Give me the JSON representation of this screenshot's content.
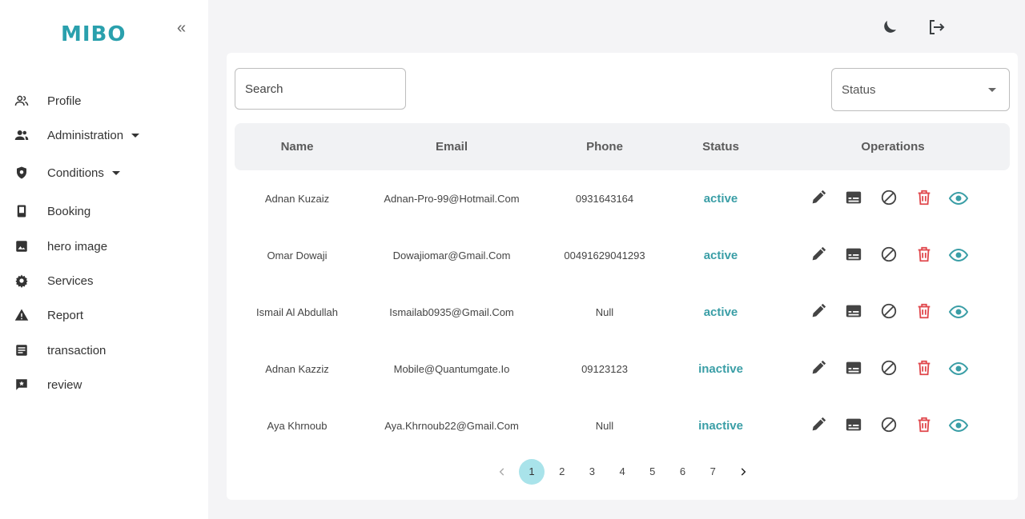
{
  "brand": {
    "logo": "MIBO",
    "accent": "#2aa0ad"
  },
  "sidebar": {
    "collapse_icon": "double-chevron-left-icon",
    "items": [
      {
        "label": "Profile",
        "icon": "users-icon"
      },
      {
        "label": "Administration",
        "icon": "group-icon",
        "has_submenu": true
      },
      {
        "label": "Conditions",
        "icon": "shield-icon",
        "has_submenu": true
      },
      {
        "label": "Booking",
        "icon": "book-icon"
      },
      {
        "label": "hero image",
        "icon": "image-icon"
      },
      {
        "label": "Services",
        "icon": "gear-icon"
      },
      {
        "label": "Report",
        "icon": "warning-icon"
      },
      {
        "label": "transaction",
        "icon": "list-icon"
      },
      {
        "label": "review",
        "icon": "review-icon"
      }
    ]
  },
  "topbar": {
    "theme_icon": "moon-icon",
    "logout_icon": "logout-icon"
  },
  "filters": {
    "search_placeholder": "Search",
    "status_label": "Status"
  },
  "table": {
    "columns": [
      "Name",
      "Email",
      "Phone",
      "Status",
      "Operations"
    ],
    "rows": [
      {
        "name": "Adnan Kuzaiz",
        "email": "Adnan-Pro-99@Hotmail.Com",
        "phone": "0931643164",
        "status": "active"
      },
      {
        "name": "Omar Dowaji",
        "email": "Dowajiomar@Gmail.Com",
        "phone": "00491629041293",
        "status": "active"
      },
      {
        "name": "Ismail Al Abdullah",
        "email": "Ismailab0935@Gmail.Com",
        "phone": "Null",
        "status": "active"
      },
      {
        "name": "Adnan Kazziz",
        "email": "Mobile@Quantumgate.Io",
        "phone": "09123123",
        "status": "inactive"
      },
      {
        "name": "Aya Khrnoub",
        "email": "Aya.Khrnoub22@Gmail.Com",
        "phone": "Null",
        "status": "inactive"
      }
    ],
    "operation_icons": [
      "edit-icon",
      "card-icon",
      "block-icon",
      "delete-icon",
      "view-icon"
    ],
    "colors": {
      "status": "#3a9ea6",
      "delete": "#e0474c",
      "view": "#3a9ea6"
    }
  },
  "pagination": {
    "pages": [
      "1",
      "2",
      "3",
      "4",
      "5",
      "6",
      "7"
    ],
    "current": "1"
  }
}
